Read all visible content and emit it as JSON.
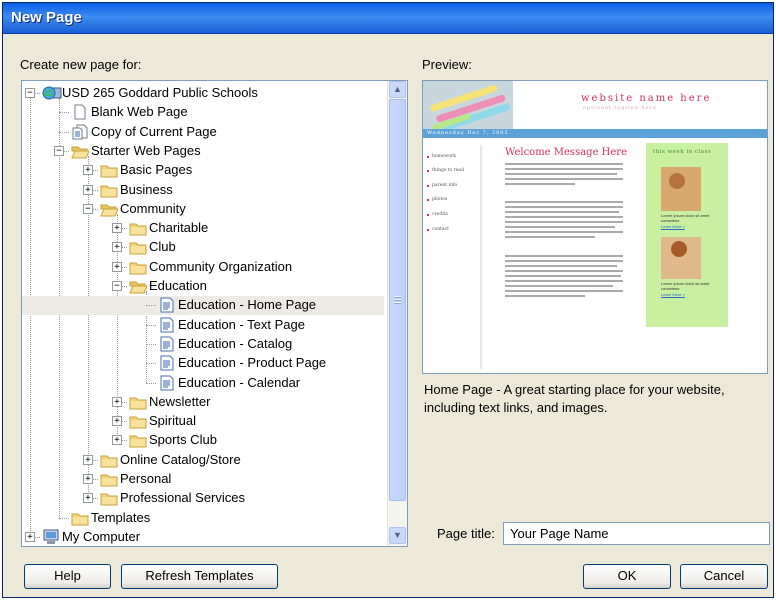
{
  "dialog": {
    "title": "New Page",
    "create_label": "Create new page for:",
    "preview_label": "Preview:",
    "page_title_label": "Page title:",
    "page_title_value": "Your Page Name",
    "description": "Home Page - A great starting place for your website, including text links, and images."
  },
  "tree": {
    "items": [
      {
        "label": "USD 265 Goddard Public Schools",
        "icon": "globe-computer-icon",
        "expander": "−"
      },
      {
        "label": "Blank Web Page",
        "icon": "blank-page-icon",
        "expander": ""
      },
      {
        "label": "Copy of Current Page",
        "icon": "copy-page-icon",
        "expander": ""
      },
      {
        "label": "Starter Web Pages",
        "icon": "folder-open-icon",
        "expander": "−"
      },
      {
        "label": "Basic Pages",
        "icon": "folder-icon",
        "expander": "+"
      },
      {
        "label": "Business",
        "icon": "folder-icon",
        "expander": "+"
      },
      {
        "label": "Community",
        "icon": "folder-open-icon",
        "expander": "−"
      },
      {
        "label": "Charitable",
        "icon": "folder-icon",
        "expander": "+"
      },
      {
        "label": "Club",
        "icon": "folder-icon",
        "expander": "+"
      },
      {
        "label": "Community Organization",
        "icon": "folder-icon",
        "expander": "+"
      },
      {
        "label": "Education",
        "icon": "folder-open-icon",
        "expander": "−"
      },
      {
        "label": "Education - Home Page",
        "icon": "template-page-icon",
        "expander": ""
      },
      {
        "label": "Education - Text Page",
        "icon": "template-page-icon",
        "expander": ""
      },
      {
        "label": "Education - Catalog",
        "icon": "template-page-icon",
        "expander": ""
      },
      {
        "label": "Education - Product Page",
        "icon": "template-page-icon",
        "expander": ""
      },
      {
        "label": "Education - Calendar",
        "icon": "template-page-icon",
        "expander": ""
      },
      {
        "label": "Newsletter",
        "icon": "folder-icon",
        "expander": "+"
      },
      {
        "label": "Spiritual",
        "icon": "folder-icon",
        "expander": "+"
      },
      {
        "label": "Sports Club",
        "icon": "folder-icon",
        "expander": "+"
      },
      {
        "label": "Online Catalog/Store",
        "icon": "folder-icon",
        "expander": "+"
      },
      {
        "label": "Personal",
        "icon": "folder-icon",
        "expander": "+"
      },
      {
        "label": "Professional Services",
        "icon": "folder-icon",
        "expander": "+"
      },
      {
        "label": "Templates",
        "icon": "folder-icon",
        "expander": ""
      },
      {
        "label": "My Computer",
        "icon": "my-computer-icon",
        "expander": "+"
      }
    ],
    "selected_index": 11
  },
  "preview": {
    "site_name": "website name here",
    "tagline": "optional tagline here",
    "date_bar": "Wednesday Dec 7, 2005",
    "nav": [
      "homework",
      "things to read",
      "parent info",
      "photos",
      "credits",
      "contact"
    ],
    "heading": "Welcome Message Here",
    "sidebar_title": "this week in class",
    "caption1": "Lorem ipsum dolor sit amet consetetur",
    "link1": "Learn More »",
    "caption2": "Lorem ipsum dolor sit amet consetetur",
    "link2": "Learn More »"
  },
  "buttons": {
    "help": "Help",
    "refresh": "Refresh Templates",
    "ok": "OK",
    "cancel": "Cancel"
  },
  "colors": {
    "titlebar": "#0a5fe6",
    "selection": "#ecebe5",
    "preview_accent": "#d0335f",
    "preview_bar": "#5aa2d8",
    "preview_sidebar": "#c8f0a0"
  }
}
